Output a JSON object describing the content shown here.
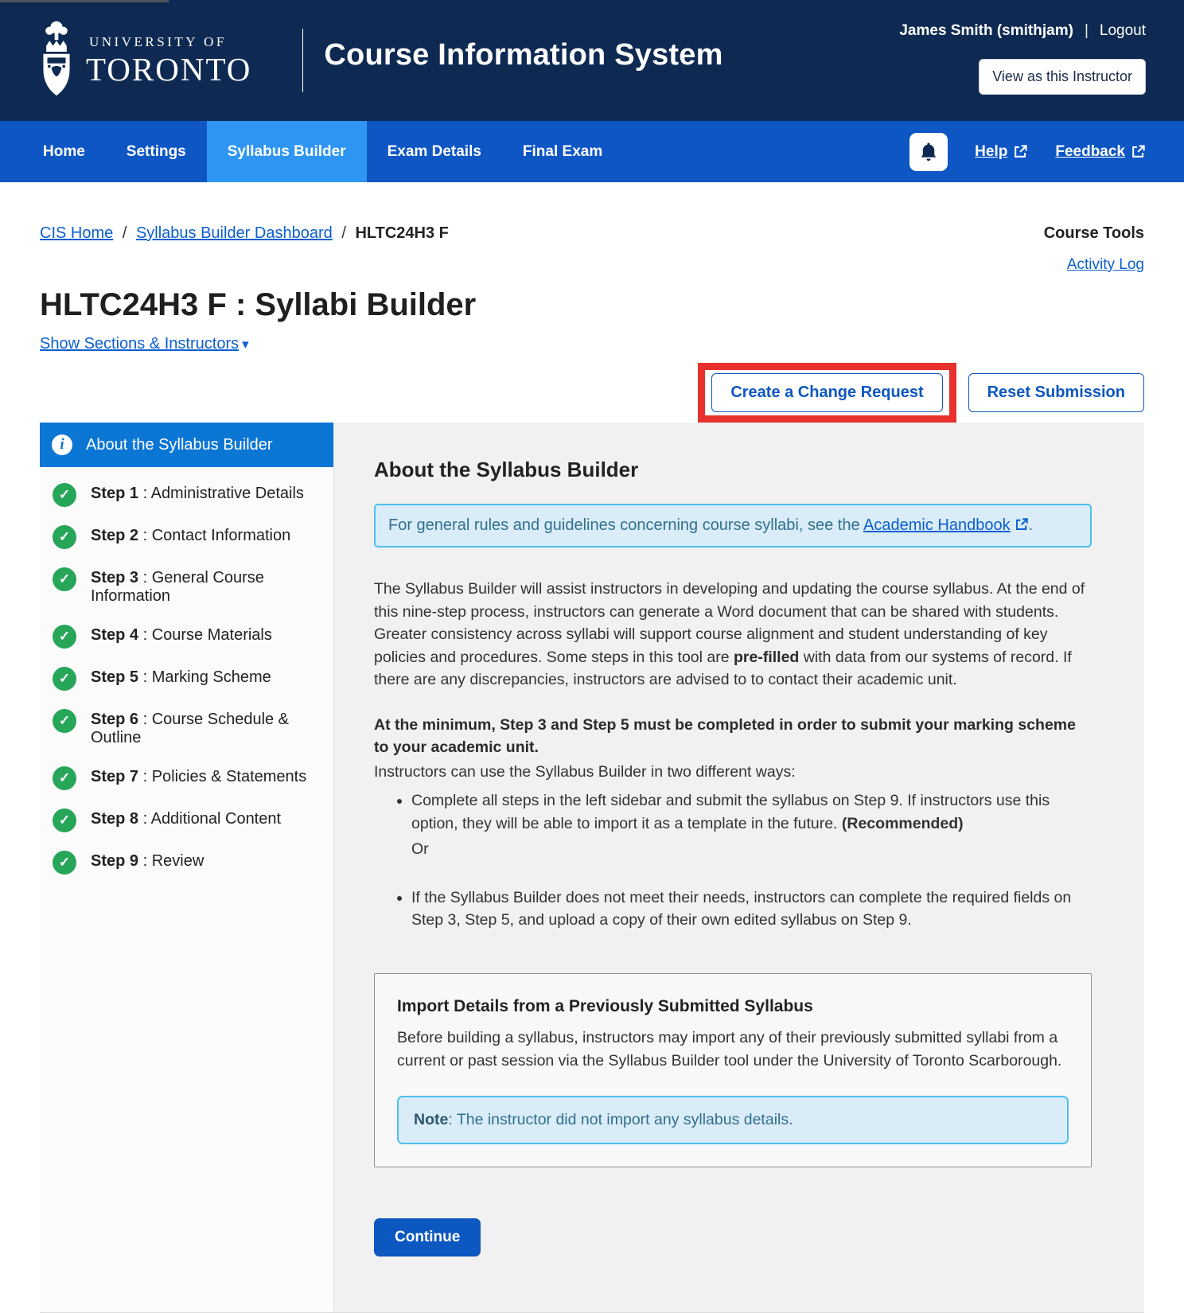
{
  "colors": {
    "header_navy": "#0f2a52",
    "nav_blue": "#0e56c4",
    "active_tab": "#2e95f2",
    "sidebar_active": "#0b76d4",
    "link_blue": "#0b5fd0",
    "check_green": "#27a65a",
    "alert_bg": "#d9ecf7",
    "alert_border": "#4cc1f0",
    "alert_text": "#31708f",
    "annotation_red": "#e8312e",
    "btn_blue": "#0d57c0"
  },
  "header": {
    "university_line1": "UNIVERSITY OF",
    "university_line2": "TORONTO",
    "app_title": "Course Information System",
    "user_name": "James Smith (smithjam)",
    "separator": "|",
    "logout": "Logout",
    "view_as": "View as this Instructor"
  },
  "nav": {
    "items": [
      {
        "label": "Home",
        "active": false
      },
      {
        "label": "Settings",
        "active": false
      },
      {
        "label": "Syllabus Builder",
        "active": true
      },
      {
        "label": "Exam Details",
        "active": false
      },
      {
        "label": "Final Exam",
        "active": false
      }
    ],
    "help": "Help",
    "feedback": "Feedback",
    "bell_icon": "bell-icon",
    "external_icon": "external-link-icon"
  },
  "breadcrumb": {
    "link1": "CIS Home",
    "link2": "Syllabus Builder Dashboard",
    "current": "HLTC24H3 F",
    "separator": "/"
  },
  "course_tools": {
    "title": "Course Tools",
    "activity_log": "Activity Log"
  },
  "page": {
    "title": "HLTC24H3 F : Syllabi Builder",
    "sections_toggle": "Show Sections & Instructors",
    "caret": "▾"
  },
  "actions": {
    "create_change_request": "Create a Change Request",
    "reset_submission": "Reset Submission"
  },
  "sidebar": {
    "about_label": "About the Syllabus Builder",
    "info_glyph": "i",
    "check_glyph": "✓",
    "steps": [
      {
        "num": "Step 1",
        "desc": " : Administrative Details"
      },
      {
        "num": "Step 2",
        "desc": " : Contact Information"
      },
      {
        "num": "Step 3",
        "desc": " : General Course Information"
      },
      {
        "num": "Step 4",
        "desc": " : Course Materials"
      },
      {
        "num": "Step 5",
        "desc": " : Marking Scheme"
      },
      {
        "num": "Step 6",
        "desc": " : Course Schedule & Outline"
      },
      {
        "num": "Step 7",
        "desc": " : Policies & Statements"
      },
      {
        "num": "Step 8",
        "desc": " : Additional Content"
      },
      {
        "num": "Step 9",
        "desc": " : Review"
      }
    ]
  },
  "content": {
    "heading": "About the Syllabus Builder",
    "alert": {
      "prefix": "For general rules and guidelines concerning course syllabi, see the ",
      "link": "Academic Handbook",
      "suffix": "."
    },
    "p1": [
      {
        "t": "The Syllabus Builder will assist instructors in developing and updating the course syllabus. At the end of this nine-step process, instructors can generate a Word document that can be shared with students. Greater consistency across syllabi will support course alignment and student understanding of key policies and procedures. Some steps in this tool are ",
        "b": false
      },
      {
        "t": "pre-filled",
        "b": true
      },
      {
        "t": " with data from our systems of record. If there are any discrepancies, instructors are advised to to contact their academic unit.",
        "b": false
      }
    ],
    "p2": "At the minimum, Step 3 and Step 5 must be completed in order to submit your marking scheme to your academic unit.",
    "p3": "Instructors can use the Syllabus Builder in two different ways:",
    "bullets": [
      {
        "segments": [
          {
            "t": "Complete all steps in the left sidebar and submit the syllabus on Step 9. If instructors use this option, they will be able to import it as a template in the future. ",
            "b": false
          },
          {
            "t": "(Recommended)",
            "b": true
          }
        ],
        "after": "Or"
      },
      {
        "segments": [
          {
            "t": "If the Syllabus Builder does not meet their needs, instructors can complete the required fields on Step 3, Step 5, and upload a copy of their own edited syllabus on Step 9.",
            "b": false
          }
        ],
        "after": ""
      }
    ],
    "import_box": {
      "title": "Import Details from a Previously Submitted Syllabus",
      "body": "Before building a syllabus, instructors may import any of their previously submitted syllabi from a current or past session via the Syllabus Builder tool under the University of Toronto Scarborough.",
      "note_label": "Note",
      "note_text": ": The instructor did not import any syllabus details."
    },
    "continue_label": "Continue"
  }
}
